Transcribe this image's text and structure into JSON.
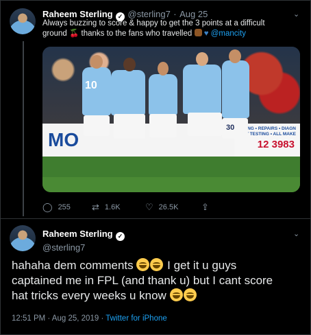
{
  "tweet1": {
    "name": "Raheem Sterling",
    "handle": "@sterling7",
    "separator": "·",
    "date": "Aug 25",
    "text_line1": "Always buzzing to score & happy to get the 3 points at a difficult",
    "text_line2_a": "ground",
    "text_line2_b": "thanks to the fans who travelled",
    "mention": "@mancity",
    "photo": {
      "banner_text": "MO",
      "banner_small_1": "CING • REPAIRS • DIAGN",
      "banner_small_2": "T TESTING • ALL MAKE",
      "banner_phone": "12 3983",
      "shirt_numbers": [
        "10",
        "30"
      ]
    },
    "replies": "255",
    "retweets": "1.6K",
    "likes": "26.5K"
  },
  "tweet2": {
    "name": "Raheem Sterling",
    "handle": "@sterling7",
    "text_line1_a": "hahaha dem comments",
    "text_line1_b": "I get it u guys",
    "text_line2": "captained me in FPL (and thank u) but I cant score",
    "text_line3": "hat tricks every weeks u know",
    "timestamp": "12:51 PM · Aug 25, 2019",
    "source_sep": "·",
    "source": "Twitter for iPhone"
  },
  "icons": {
    "reply": "reply-icon",
    "retweet": "retweet-icon",
    "like": "like-icon",
    "verified": "verified-icon",
    "more": "chevron-down-icon"
  },
  "colors": {
    "link": "#1da1f2",
    "background": "#000000",
    "muted": "#8b98a5"
  }
}
